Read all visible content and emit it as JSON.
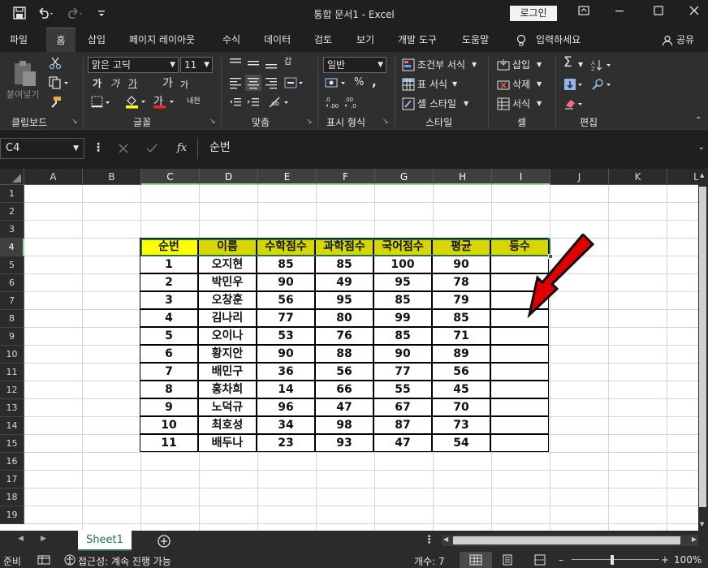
{
  "titlebar": {
    "title": "통합 문서1 - Excel",
    "login_label": "로그인",
    "icons": [
      "save-icon",
      "undo-icon",
      "redo-icon",
      "customize-icon"
    ]
  },
  "menu": {
    "tabs": [
      "파일",
      "홈",
      "삽입",
      "페이지 레이아웃",
      "수식",
      "데이터",
      "검토",
      "보기",
      "개발 도구",
      "도움말"
    ],
    "search_label": "입력하세요",
    "share_label": "공유"
  },
  "ribbon": {
    "clipboard": {
      "paste_label": "붙여넣기",
      "group_label": "클립보드"
    },
    "font": {
      "font_name": "맑은 고딕",
      "font_size": "11",
      "group_label": "글꼴",
      "bold": "가",
      "italic": "가",
      "underline": "가",
      "grow": "가",
      "shrink": "가",
      "strike": "가",
      "phonetic": "내천"
    },
    "alignment": {
      "group_label": "맞춤",
      "wrap": "갑"
    },
    "number": {
      "format": "일반",
      "group_label": "표시 형식"
    },
    "styles": {
      "conditional": "조건부 서식",
      "table": "표 서식",
      "cell": "셀 스타일",
      "group_label": "스타일"
    },
    "cells": {
      "insert": "삽입",
      "delete": "삭제",
      "format": "서식",
      "group_label": "셀"
    },
    "editing": {
      "group_label": "편집"
    }
  },
  "formula": {
    "namebox": "C4",
    "fx_label": "fx",
    "content": "순번"
  },
  "grid": {
    "columns": [
      "A",
      "B",
      "C",
      "D",
      "E",
      "F",
      "G",
      "H",
      "I",
      "J",
      "K",
      "L"
    ],
    "rows": [
      "1",
      "2",
      "3",
      "4",
      "5",
      "6",
      "7",
      "8",
      "9",
      "10",
      "11",
      "12",
      "13",
      "14",
      "15",
      "16",
      "17",
      "18",
      "19"
    ]
  },
  "table": {
    "headers": [
      "순번",
      "이름",
      "수학점수",
      "과학점수",
      "국어점수",
      "평균",
      "등수"
    ],
    "rows": [
      [
        "1",
        "오지현",
        "85",
        "85",
        "100",
        "90",
        ""
      ],
      [
        "2",
        "박민우",
        "90",
        "49",
        "95",
        "78",
        ""
      ],
      [
        "3",
        "오창훈",
        "56",
        "95",
        "85",
        "79",
        ""
      ],
      [
        "4",
        "김나리",
        "77",
        "80",
        "99",
        "85",
        ""
      ],
      [
        "5",
        "오이나",
        "53",
        "76",
        "85",
        "71",
        ""
      ],
      [
        "6",
        "황지안",
        "90",
        "88",
        "90",
        "89",
        ""
      ],
      [
        "7",
        "배민구",
        "36",
        "56",
        "77",
        "56",
        ""
      ],
      [
        "8",
        "홍차희",
        "14",
        "66",
        "55",
        "45",
        ""
      ],
      [
        "9",
        "노덕규",
        "96",
        "47",
        "67",
        "70",
        ""
      ],
      [
        "10",
        "최호성",
        "34",
        "98",
        "87",
        "73",
        ""
      ],
      [
        "11",
        "배두나",
        "23",
        "93",
        "47",
        "54",
        ""
      ]
    ]
  },
  "sheets": {
    "active": "Sheet1"
  },
  "status": {
    "ready": "준비",
    "accessibility": "접근성: 계속 진행 가능",
    "count": "개수: 7",
    "zoom": "100%"
  },
  "colors": {
    "accent": "#217346",
    "header_fill": "#ffff00",
    "header_fill_dark": "#d6d600",
    "arrow": "#e00000"
  }
}
